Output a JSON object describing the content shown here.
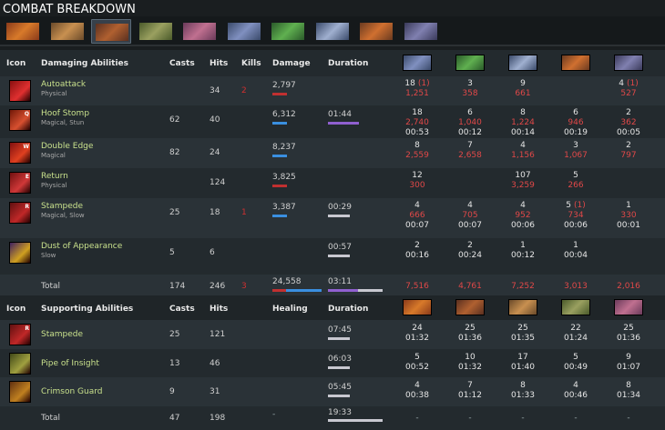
{
  "page": {
    "title": "COMBAT BREAKDOWN"
  },
  "colors": {
    "bg": "#232a2e",
    "alt_row": "#2a3237",
    "ability_name": "#c8e08c",
    "damage_red": "#e04848",
    "bar_blue": "#3a8fe0",
    "bar_red": "#c03030",
    "bar_purple": "#9060d0"
  },
  "tabs": [
    {
      "icon": "hero-centaur-icon"
    },
    {
      "icon": "hero-icon-2"
    },
    {
      "icon": "hero-icon-3",
      "selected": true
    },
    {
      "icon": "hero-icon-4"
    },
    {
      "icon": "hero-icon-5"
    },
    {
      "icon": "hero-icon-6"
    },
    {
      "icon": "hero-icon-7"
    },
    {
      "icon": "hero-icon-8"
    },
    {
      "icon": "hero-icon-9"
    },
    {
      "icon": "hero-icon-10"
    }
  ],
  "damage_header": {
    "icon": "Icon",
    "abilities": "Damaging Abilities",
    "casts": "Casts",
    "hits": "Hits",
    "kills": "Kills",
    "damage": "Damage",
    "duration": "Duration"
  },
  "damage_rows": [
    {
      "name": "Autoattack",
      "sub": "Physical",
      "casts": "",
      "hits": "34",
      "kills": "2",
      "damage": "2,797",
      "duration": "",
      "targets": [
        {
          "hits": "18",
          "extra": "(1)",
          "val": "1,251",
          "time": ""
        },
        {
          "hits": "3",
          "val": "358",
          "time": ""
        },
        {
          "hits": "9",
          "val": "661",
          "time": ""
        },
        {
          "hits": "",
          "val": "",
          "time": ""
        },
        {
          "hits": "4",
          "extra": "(1)",
          "val": "527",
          "time": ""
        }
      ]
    },
    {
      "name": "Hoof Stomp",
      "sub": "Magical, Stun",
      "key": "Q",
      "casts": "62",
      "hits": "40",
      "kills": "",
      "damage": "6,312",
      "duration": "01:44",
      "targets": [
        {
          "hits": "18",
          "val": "2,740",
          "time": "00:53"
        },
        {
          "hits": "6",
          "val": "1,040",
          "time": "00:12"
        },
        {
          "hits": "8",
          "val": "1,224",
          "time": "00:14"
        },
        {
          "hits": "6",
          "val": "946",
          "time": "00:19"
        },
        {
          "hits": "2",
          "val": "362",
          "time": "00:05"
        }
      ]
    },
    {
      "name": "Double Edge",
      "sub": "Magical",
      "key": "W",
      "casts": "82",
      "hits": "24",
      "kills": "",
      "damage": "8,237",
      "duration": "",
      "targets": [
        {
          "hits": "8",
          "val": "2,559",
          "time": ""
        },
        {
          "hits": "7",
          "val": "2,658",
          "time": ""
        },
        {
          "hits": "4",
          "val": "1,156",
          "time": ""
        },
        {
          "hits": "3",
          "val": "1,067",
          "time": ""
        },
        {
          "hits": "2",
          "val": "797",
          "time": ""
        }
      ]
    },
    {
      "name": "Return",
      "sub": "Physical",
      "key": "E",
      "casts": "",
      "hits": "124",
      "kills": "",
      "damage": "3,825",
      "duration": "",
      "targets": [
        {
          "hits": "12",
          "val": "300",
          "time": ""
        },
        {
          "hits": "",
          "val": "",
          "time": ""
        },
        {
          "hits": "107",
          "val": "3,259",
          "time": ""
        },
        {
          "hits": "5",
          "val": "266",
          "time": ""
        },
        {
          "hits": "",
          "val": "",
          "time": ""
        }
      ]
    },
    {
      "name": "Stampede",
      "sub": "Magical, Slow",
      "key": "R",
      "casts": "25",
      "hits": "18",
      "kills": "1",
      "damage": "3,387",
      "duration": "00:29",
      "targets": [
        {
          "hits": "4",
          "val": "666",
          "time": "00:07"
        },
        {
          "hits": "4",
          "val": "705",
          "time": "00:07"
        },
        {
          "hits": "4",
          "val": "952",
          "time": "00:06"
        },
        {
          "hits": "5",
          "extra": "(1)",
          "val": "734",
          "time": "00:06"
        },
        {
          "hits": "1",
          "val": "330",
          "time": "00:01"
        }
      ]
    },
    {
      "name": "Dust of Appearance",
      "sub": "Slow",
      "casts": "5",
      "hits": "6",
      "kills": "",
      "damage": "",
      "duration": "00:57",
      "targets": [
        {
          "hits": "2",
          "val": "",
          "time": "00:16"
        },
        {
          "hits": "2",
          "val": "",
          "time": "00:24"
        },
        {
          "hits": "1",
          "val": "",
          "time": "00:12"
        },
        {
          "hits": "1",
          "val": "",
          "time": "00:04"
        },
        {
          "hits": "",
          "val": "",
          "time": ""
        }
      ]
    }
  ],
  "damage_total": {
    "label": "Total",
    "casts": "174",
    "hits": "246",
    "kills": "3",
    "damage": "24,558",
    "duration": "03:11",
    "targets": [
      "7,516",
      "4,761",
      "7,252",
      "3,013",
      "2,016"
    ]
  },
  "support_header": {
    "icon": "Icon",
    "abilities": "Supporting Abilities",
    "casts": "Casts",
    "hits": "Hits",
    "healing": "Healing",
    "duration": "Duration"
  },
  "support_rows": [
    {
      "name": "Stampede",
      "key": "R",
      "casts": "25",
      "hits": "121",
      "healing": "",
      "duration": "07:45",
      "targets": [
        {
          "hits": "24",
          "time": "01:32"
        },
        {
          "hits": "25",
          "time": "01:36"
        },
        {
          "hits": "25",
          "time": "01:35"
        },
        {
          "hits": "22",
          "time": "01:24"
        },
        {
          "hits": "25",
          "time": "01:36"
        }
      ]
    },
    {
      "name": "Pipe of Insight",
      "casts": "13",
      "hits": "46",
      "healing": "",
      "duration": "06:03",
      "targets": [
        {
          "hits": "5",
          "time": "00:52"
        },
        {
          "hits": "10",
          "time": "01:32"
        },
        {
          "hits": "17",
          "time": "01:40"
        },
        {
          "hits": "5",
          "time": "00:49"
        },
        {
          "hits": "9",
          "time": "01:07"
        }
      ]
    },
    {
      "name": "Crimson Guard",
      "casts": "9",
      "hits": "31",
      "healing": "",
      "duration": "05:45",
      "targets": [
        {
          "hits": "4",
          "time": "00:38"
        },
        {
          "hits": "7",
          "time": "01:12"
        },
        {
          "hits": "8",
          "time": "01:33"
        },
        {
          "hits": "4",
          "time": "00:46"
        },
        {
          "hits": "8",
          "time": "01:34"
        }
      ]
    }
  ],
  "support_total": {
    "label": "Total",
    "casts": "47",
    "hits": "198",
    "healing": "-",
    "duration": "19:33",
    "targets": [
      "-",
      "-",
      "-",
      "-",
      "-"
    ]
  }
}
